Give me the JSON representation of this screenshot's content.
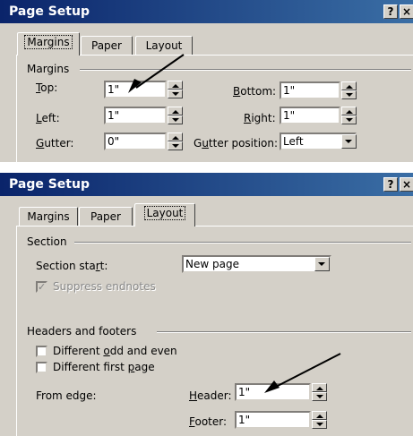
{
  "dialog1": {
    "title": "Page Setup",
    "help_label": "?",
    "close_label": "×",
    "tabs": [
      {
        "label": "Margins",
        "active": true
      },
      {
        "label": "Paper",
        "active": false
      },
      {
        "label": "Layout",
        "active": false
      }
    ],
    "group_label": "Margins",
    "top_label": "Top:",
    "top_value": "1\"",
    "bottom_label": "Bottom:",
    "bottom_value": "1\"",
    "left_label": "Left:",
    "left_value": "1\"",
    "right_label": "Right:",
    "right_value": "1\"",
    "gutter_label": "Gutter:",
    "gutter_value": "0\"",
    "gutter_position_label": "Gutter position:",
    "gutter_position_value": "Left"
  },
  "dialog2": {
    "title": "Page Setup",
    "help_label": "?",
    "close_label": "×",
    "tabs": [
      {
        "label": "Margins",
        "active": false
      },
      {
        "label": "Paper",
        "active": false
      },
      {
        "label": "Layout",
        "active": true
      }
    ],
    "section_group_label": "Section",
    "section_start_label": "Section start:",
    "section_start_value": "New page",
    "suppress_endnotes_label": "Suppress endnotes",
    "suppress_endnotes_checked": true,
    "headers_footers_label": "Headers and footers",
    "different_odd_even_label": "Different odd and even",
    "different_first_page_label": "Different first page",
    "from_edge_label": "From edge:",
    "header_label": "Header:",
    "header_value": "1\"",
    "footer_label": "Footer:",
    "footer_value": "1\""
  },
  "colors": {
    "titlebar_start": "#0a246a",
    "titlebar_end": "#3a6ea5",
    "dialog_face": "#d4d0c8"
  }
}
